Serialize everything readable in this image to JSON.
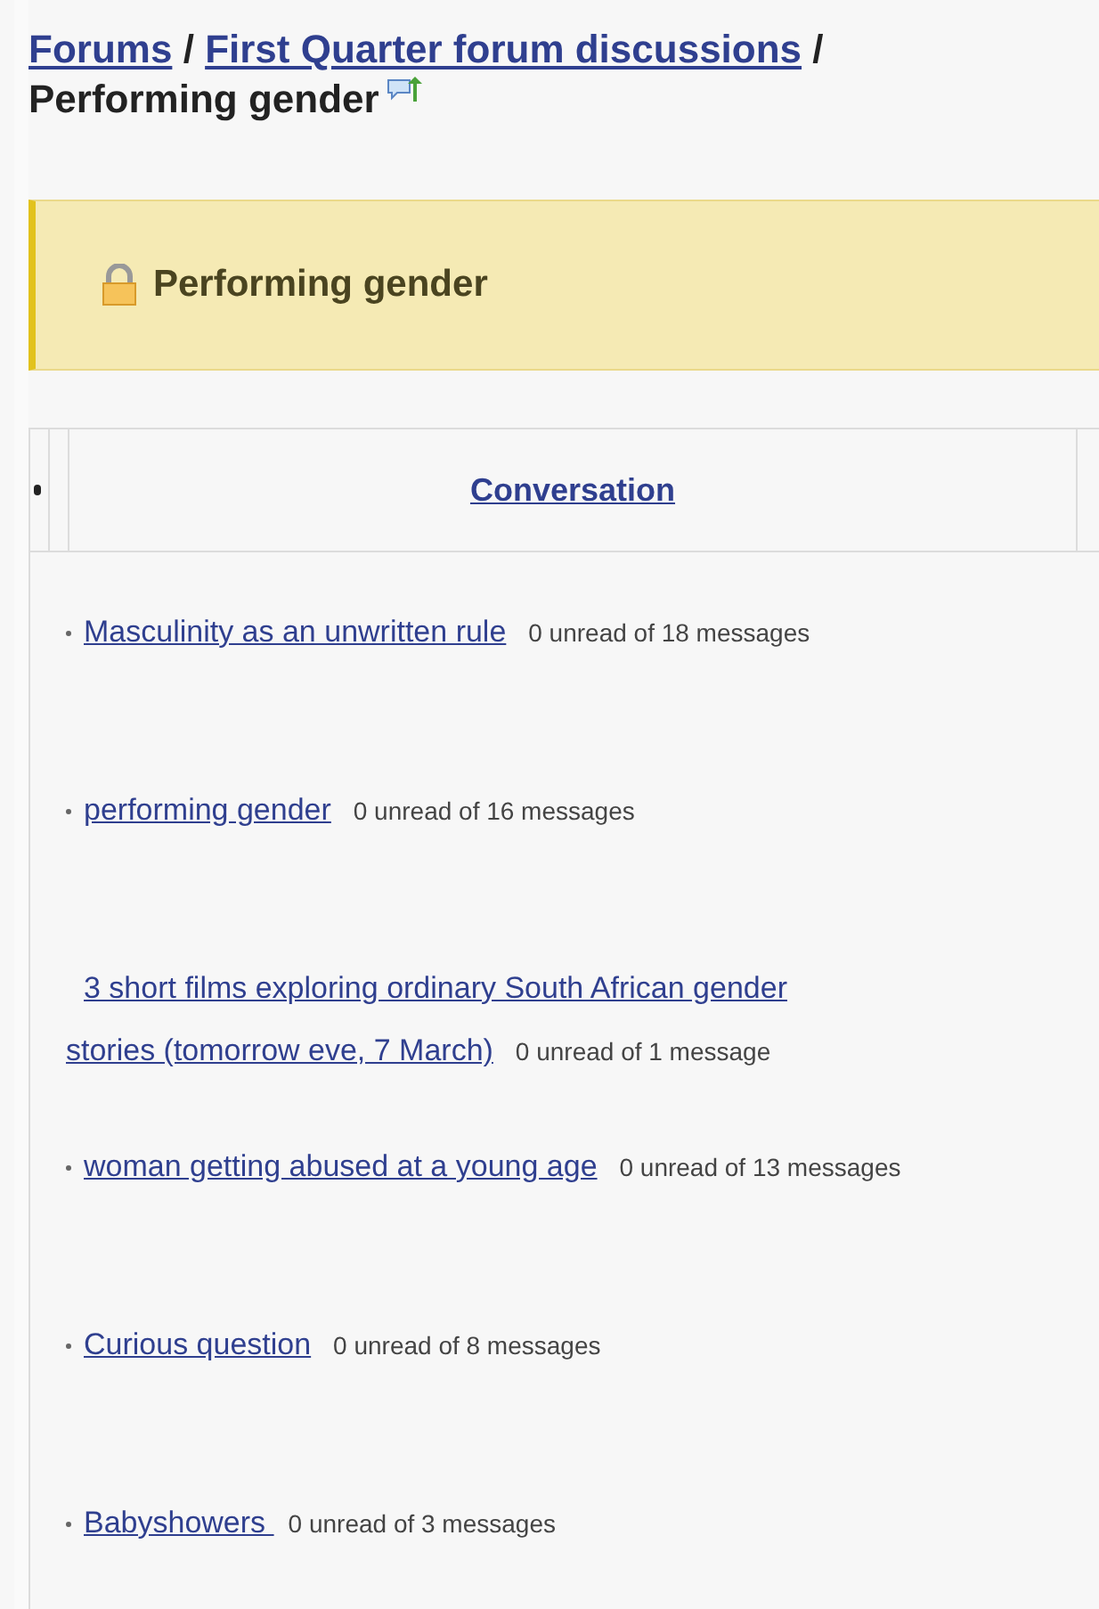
{
  "breadcrumb": {
    "links": [
      "Forums",
      "First Quarter forum discussions"
    ],
    "separator": "/",
    "current": "Performing gender"
  },
  "banner": {
    "title": "Performing gender",
    "locked": true
  },
  "table": {
    "columns": [
      "Conversation"
    ],
    "rows": [
      {
        "title_lines": [
          "Masculinity as an unwritten rule"
        ],
        "count": "0 unread of 18 messages",
        "bullet": true
      },
      {
        "title_lines": [
          "performing gender"
        ],
        "count": "0 unread of 16 messages",
        "bullet": true
      },
      {
        "title_lines": [
          "3 short films exploring ordinary South African gender",
          "stories (tomorrow eve, 7 March)"
        ],
        "count": "0 unread of 1 message",
        "bullet": false
      },
      {
        "title_lines": [
          "woman getting abused at a young age"
        ],
        "count": "0 unread of 13 messages",
        "bullet": true
      },
      {
        "title_lines": [
          "Curious question"
        ],
        "count": "0 unread of 8 messages",
        "bullet": true
      },
      {
        "title_lines": [
          "Babyshowers "
        ],
        "count": "0 unread of 3 messages",
        "bullet": true
      }
    ]
  }
}
